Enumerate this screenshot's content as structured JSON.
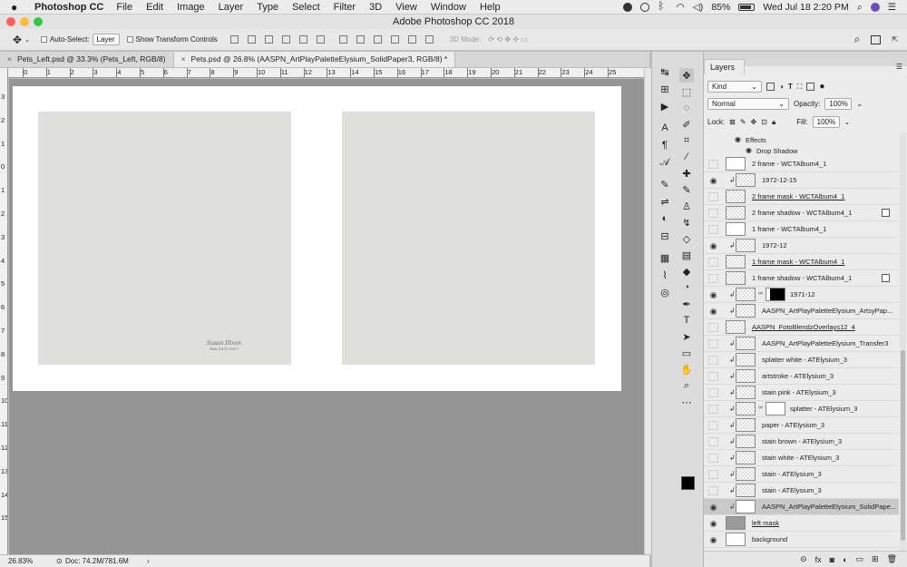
{
  "menubar": {
    "app_name": "Photoshop CC",
    "items": [
      "File",
      "Edit",
      "Image",
      "Layer",
      "Type",
      "Select",
      "Filter",
      "3D",
      "View",
      "Window",
      "Help"
    ],
    "battery_level": 0.85,
    "battery_text": "85%",
    "datetime": "Wed Jul 18  2:20 PM",
    "status_icons": [
      "creative-cloud-icon",
      "cc-sync-icon",
      "bluetooth-icon",
      "wifi-icon",
      "volume-icon",
      "battery-icon",
      "search-icon",
      "siri-icon",
      "menu-list-icon"
    ]
  },
  "window": {
    "title": "Adobe Photoshop CC 2018",
    "traffic_colors": [
      "#fc605c",
      "#fdbc40",
      "#34c84a"
    ]
  },
  "options_bar": {
    "auto_select_label": "Auto-Select:",
    "auto_select_value": "Layer",
    "transform_label": "Show Transform Controls",
    "mode_3d_label": "3D Mode:"
  },
  "tabs": [
    {
      "label": "Pets_Left.psd @ 33.3% (Pets_Left, RGB/8)",
      "active": false
    },
    {
      "label": "Pets.psd @ 26.8% (AASPN_ArtPlayPaletteElysium_SolidPaper3, RGB/8) *",
      "active": true
    }
  ],
  "ruler": {
    "top_labels": [
      "0",
      "1",
      "2",
      "3",
      "4",
      "5",
      "6",
      "7",
      "8",
      "9",
      "10",
      "11",
      "12",
      "13",
      "14",
      "15",
      "16",
      "17",
      "18",
      "19",
      "20",
      "21",
      "22",
      "23",
      "24",
      "25"
    ],
    "left_labels": [
      "3",
      "2",
      "1",
      "0",
      "1",
      "2",
      "3",
      "4",
      "5",
      "6",
      "7",
      "8",
      "9",
      "10",
      "11",
      "12",
      "13",
      "14",
      "15"
    ]
  },
  "document": {
    "signature_line1": "Susan Dixon",
    "signature_line2": "Pets 1971-1972"
  },
  "statusbar": {
    "zoom": "26.83%",
    "doc_info": "Doc: 74.2M/781.6M"
  },
  "tools": {
    "col1": [
      "move-icon",
      "artboard-icon",
      "play-icon",
      "character-icon",
      "paragraph-icon",
      "glyphs-icon",
      "brush-settings-icon",
      "adjustments-icon",
      "color-icon",
      "properties-icon",
      "grid-icon",
      "paths-icon",
      "cc-libraries-icon"
    ],
    "col2": [
      "move-tool-icon",
      "marquee-icon",
      "lasso-icon",
      "quick-select-icon",
      "crop-icon",
      "eyedropper-icon",
      "healing-icon",
      "brush-icon",
      "stamp-icon",
      "history-brush-icon",
      "eraser-icon",
      "gradient-icon",
      "blur-icon",
      "dodge-icon",
      "pen-icon",
      "type-icon",
      "path-select-icon",
      "rectangle-icon",
      "hand-icon",
      "zoom-icon",
      "more-icon"
    ]
  },
  "layers_panel": {
    "title": "Layers",
    "kind_label": "Kind",
    "blend_mode": "Normal",
    "opacity_label": "Opacity:",
    "opacity_value": "100%",
    "lock_label": "Lock:",
    "fill_label": "Fill:",
    "fill_value": "100%",
    "effects_label": "Effects",
    "drop_shadow_label": "Drop Shadow",
    "layers": [
      {
        "name": "2 frame - WCTAlbum4_1",
        "visible": false,
        "clip": false,
        "underline": false,
        "selected": false,
        "thumb": "plain",
        "fx": false
      },
      {
        "name": "1972-12-15",
        "visible": true,
        "clip": true,
        "underline": false,
        "selected": false,
        "thumb": "checker",
        "fx": false
      },
      {
        "name": "2 frame mask - WCTAlbum4_1",
        "visible": false,
        "clip": false,
        "underline": true,
        "selected": false,
        "thumb": "checker",
        "fx": false
      },
      {
        "name": "2 frame shadow - WCTAlbum4_1",
        "visible": false,
        "clip": false,
        "underline": false,
        "selected": false,
        "thumb": "checker",
        "fx": true
      },
      {
        "name": "1 frame - WCTAlbum4_1",
        "visible": false,
        "clip": false,
        "underline": false,
        "selected": false,
        "thumb": "plain",
        "fx": false
      },
      {
        "name": "1972-12",
        "visible": true,
        "clip": true,
        "underline": false,
        "selected": false,
        "thumb": "checker",
        "fx": false
      },
      {
        "name": "1 frame mask - WCTAlbum4_1",
        "visible": false,
        "clip": false,
        "underline": true,
        "selected": false,
        "thumb": "checker",
        "fx": false
      },
      {
        "name": "1 frame shadow - WCTAlbum4_1",
        "visible": false,
        "clip": false,
        "underline": false,
        "selected": false,
        "thumb": "checker",
        "fx": true
      },
      {
        "name": "1971-12",
        "visible": true,
        "clip": true,
        "underline": false,
        "selected": false,
        "thumb": "checker",
        "fx": false,
        "mask": "black"
      },
      {
        "name": "AASPN_ArtPlayPaletteElysium_ArtsyPap...",
        "visible": true,
        "clip": true,
        "underline": false,
        "selected": false,
        "thumb": "checker",
        "fx": false
      },
      {
        "name": "AASPN_FotoBlendzOverlays12_4",
        "visible": false,
        "clip": false,
        "underline": true,
        "selected": false,
        "thumb": "checker",
        "fx": false
      },
      {
        "name": "AASPN_ArtPlayPaletteElysium_Transfer3",
        "visible": false,
        "clip": true,
        "underline": false,
        "selected": false,
        "thumb": "checker",
        "fx": false
      },
      {
        "name": "splatter white - ATElysium_3",
        "visible": false,
        "clip": true,
        "underline": false,
        "selected": false,
        "thumb": "checker",
        "fx": false
      },
      {
        "name": "artstroke - ATElysium_3",
        "visible": false,
        "clip": true,
        "underline": false,
        "selected": false,
        "thumb": "checker",
        "fx": false
      },
      {
        "name": "stain pink - ATElysium_3",
        "visible": false,
        "clip": true,
        "underline": false,
        "selected": false,
        "thumb": "checker",
        "fx": false
      },
      {
        "name": "splatter - ATElysium_3",
        "visible": false,
        "clip": true,
        "underline": false,
        "selected": false,
        "thumb": "checker",
        "fx": false,
        "mask": "white"
      },
      {
        "name": "paper - ATElysium_3",
        "visible": false,
        "clip": true,
        "underline": false,
        "selected": false,
        "thumb": "checker",
        "fx": false
      },
      {
        "name": "stain brown - ATElysium_3",
        "visible": false,
        "clip": true,
        "underline": false,
        "selected": false,
        "thumb": "checker",
        "fx": false
      },
      {
        "name": "stain white - ATElysium_3",
        "visible": false,
        "clip": true,
        "underline": false,
        "selected": false,
        "thumb": "checker",
        "fx": false
      },
      {
        "name": "stain - ATElysium_3",
        "visible": false,
        "clip": true,
        "underline": false,
        "selected": false,
        "thumb": "checker",
        "fx": false
      },
      {
        "name": "stain - ATElysium_3",
        "visible": false,
        "clip": true,
        "underline": false,
        "selected": false,
        "thumb": "checker",
        "fx": false
      },
      {
        "name": "AASPN_ArtPlayPaletteElysium_SolidPape...",
        "visible": true,
        "clip": true,
        "underline": false,
        "selected": true,
        "thumb": "plain",
        "fx": false
      },
      {
        "name": "left mask",
        "visible": true,
        "clip": false,
        "underline": true,
        "selected": false,
        "thumb": "grey",
        "fx": false
      },
      {
        "name": "background",
        "visible": true,
        "clip": false,
        "underline": false,
        "selected": false,
        "thumb": "plain",
        "fx": false
      }
    ],
    "footer_icons": [
      "link-icon",
      "fx-icon",
      "add-mask-icon",
      "adjustment-layer-icon",
      "new-group-icon",
      "new-layer-icon",
      "trash-icon"
    ]
  }
}
